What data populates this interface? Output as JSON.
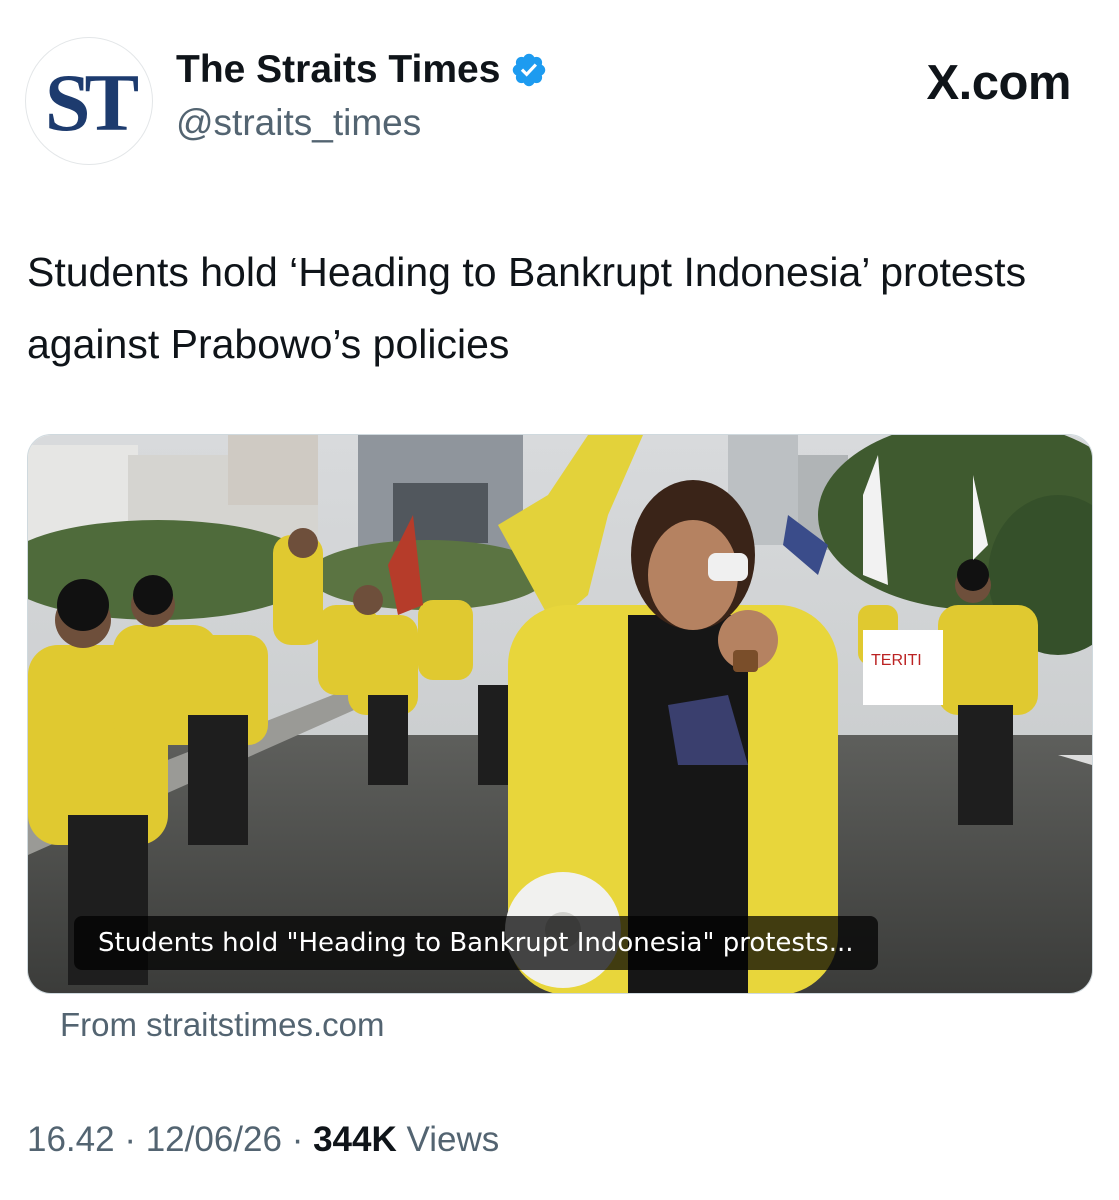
{
  "account": {
    "avatar_text": "ST",
    "display_name": "The Straits Times",
    "handle": "@straits_times",
    "verified_badge": "verified-check-icon",
    "badge_color": "#1d9bf0"
  },
  "source_site": "X.com",
  "tweet": {
    "text": "Students hold ‘Heading to Bankrupt Indonesia’ protests against Prabowo’s policies"
  },
  "card": {
    "image_description_icon": "protest-photo",
    "caption": "Students hold \"Heading to Bankrupt Indonesia\" protests...",
    "source": "From straitstimes.com"
  },
  "meta": {
    "time": "16.42",
    "separator": "·",
    "date": "12/06/26",
    "views_count": "344K",
    "views_label": "Views"
  }
}
